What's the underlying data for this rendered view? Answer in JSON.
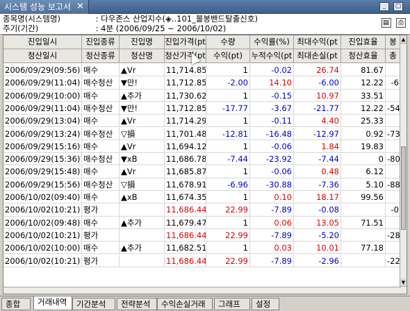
{
  "window": {
    "tab_title": "시스템 성능 보고서",
    "close_glyph": "✕"
  },
  "info": {
    "symbol_label": "종목명(시스템명)",
    "symbol_value": ": 다우존스 산업지수(◈..101_볼봉밴드탈출신호)",
    "period_label": "주기(기간)",
    "period_value": ": 4분 (2006/09/25 ~ 2006/10/02)"
  },
  "headers_top": [
    "진입일시",
    "진입종류",
    "진입명",
    "진입가격(pt",
    "수량",
    "수익률(%)",
    "최대수익(pt",
    "진입효율",
    "봉"
  ],
  "headers_bottom": [
    "청산일시",
    "청산종류",
    "청산명",
    "청산가격(pt",
    "수익(pt)",
    "누적수익(pt",
    "최대손실(pt",
    "청산효율",
    "총"
  ],
  "colors": {
    "red": "#e00000",
    "blue": "#0000d0",
    "black": "#000000"
  },
  "rows": [
    {
      "date": "2006/09/29(09:56)",
      "type": "매수",
      "name": "▲Vr",
      "price": "11,714.85",
      "pcolor": "black",
      "qty": "1",
      "qcolor": "black",
      "rate": "-0.02",
      "rcolor": "blue",
      "max": "26.74",
      "mcolor": "red",
      "eff": "81.67",
      "bar": ""
    },
    {
      "date": "2006/09/29(11:04)",
      "type": "매수청산",
      "name": "▼만!",
      "price": "11,712.85",
      "pcolor": "black",
      "qty": "-2.00",
      "qcolor": "blue",
      "rate": "14.10",
      "rcolor": "red",
      "max": "-6.00",
      "mcolor": "blue",
      "eff": "12.22",
      "bar": "-6"
    },
    {
      "date": "2006/09/29(10:00)",
      "type": "매수",
      "name": "▲추가",
      "price": "11,730.62",
      "pcolor": "black",
      "qty": "1",
      "qcolor": "black",
      "rate": "-0.15",
      "rcolor": "blue",
      "max": "10.97",
      "mcolor": "red",
      "eff": "33.51",
      "bar": ""
    },
    {
      "date": "2006/09/29(11:04)",
      "type": "매수청산",
      "name": "▼만!",
      "price": "11,712.85",
      "pcolor": "black",
      "qty": "-17.77",
      "qcolor": "blue",
      "rate": "-3.67",
      "rcolor": "blue",
      "max": "-21.77",
      "mcolor": "blue",
      "eff": "12.22",
      "bar": "-54"
    },
    {
      "date": "2006/09/29(13:04)",
      "type": "매수",
      "name": "▲Vr",
      "price": "11,714.29",
      "pcolor": "black",
      "qty": "1",
      "qcolor": "black",
      "rate": "-0.11",
      "rcolor": "blue",
      "max": "4.40",
      "mcolor": "red",
      "eff": "25.33",
      "bar": ""
    },
    {
      "date": "2006/09/29(13:24)",
      "type": "매수청산",
      "name": "▽損",
      "price": "11,701.48",
      "pcolor": "black",
      "qty": "-12.81",
      "qcolor": "blue",
      "rate": "-16.48",
      "rcolor": "blue",
      "max": "-12.97",
      "mcolor": "blue",
      "eff": "0.92",
      "bar": "-73"
    },
    {
      "date": "2006/09/29(15:16)",
      "type": "매수",
      "name": "▲Vr",
      "price": "11,694.12",
      "pcolor": "black",
      "qty": "1",
      "qcolor": "black",
      "rate": "-0.06",
      "rcolor": "blue",
      "max": "1.84",
      "mcolor": "red",
      "eff": "19.83",
      "bar": ""
    },
    {
      "date": "2006/09/29(15:36)",
      "type": "매수청산",
      "name": "▼xB",
      "price": "11,686.78",
      "pcolor": "black",
      "qty": "-7.44",
      "qcolor": "blue",
      "rate": "-23.92",
      "rcolor": "blue",
      "max": "-7.44",
      "mcolor": "blue",
      "eff": "0",
      "bar": "-80"
    },
    {
      "date": "2006/09/29(15:48)",
      "type": "매수",
      "name": "▲Vr",
      "price": "11,685.87",
      "pcolor": "black",
      "qty": "1",
      "qcolor": "black",
      "rate": "-0.06",
      "rcolor": "blue",
      "max": "0.48",
      "mcolor": "red",
      "eff": "6.12",
      "bar": ""
    },
    {
      "date": "2006/09/29(15:56)",
      "type": "매수청산",
      "name": "▽損",
      "price": "11,678.91",
      "pcolor": "black",
      "qty": "-6.96",
      "qcolor": "blue",
      "rate": "-30.88",
      "rcolor": "blue",
      "max": "-7.36",
      "mcolor": "blue",
      "eff": "5.10",
      "bar": "-88"
    },
    {
      "date": "2006/10/02(09:40)",
      "type": "매수",
      "name": "▲xB",
      "price": "11,674.35",
      "pcolor": "black",
      "qty": "1",
      "qcolor": "black",
      "rate": "0.10",
      "rcolor": "red",
      "max": "18.17",
      "mcolor": "red",
      "eff": "99.56",
      "bar": ""
    },
    {
      "date": "2006/10/02(10:21)",
      "type": "평가",
      "name": "",
      "price": "11,686.44",
      "pcolor": "red",
      "qty": "22.99",
      "qcolor": "red",
      "rate": "-7.89",
      "rcolor": "blue",
      "max": "-0.08",
      "mcolor": "blue",
      "eff": "",
      "bar": "-0"
    },
    {
      "date": "2006/10/02(09:48)",
      "type": "매수",
      "name": "▲추가",
      "price": "11,679.47",
      "pcolor": "black",
      "qty": "1",
      "qcolor": "black",
      "rate": "0.06",
      "rcolor": "red",
      "max": "13.05",
      "mcolor": "red",
      "eff": "71.51",
      "bar": ""
    },
    {
      "date": "2006/10/02(10:21)",
      "type": "평가",
      "name": "",
      "price": "11,686.44",
      "pcolor": "red",
      "qty": "22.99",
      "qcolor": "red",
      "rate": "-7.89",
      "rcolor": "blue",
      "max": "-5.20",
      "mcolor": "blue",
      "eff": "",
      "bar": "-28"
    },
    {
      "date": "2006/10/02(10:00)",
      "type": "매수",
      "name": "▲추가",
      "price": "11,682.51",
      "pcolor": "black",
      "qty": "1",
      "qcolor": "black",
      "rate": "0.03",
      "rcolor": "red",
      "max": "10.01",
      "mcolor": "red",
      "eff": "77.18",
      "bar": ""
    },
    {
      "date": "2006/10/02(10:21)",
      "type": "평가",
      "name": "",
      "price": "11,686.44",
      "pcolor": "red",
      "qty": "22.99",
      "qcolor": "red",
      "rate": "-7.89",
      "rcolor": "blue",
      "max": "-2.96",
      "mcolor": "blue",
      "eff": "",
      "bar": "-22"
    }
  ],
  "bottom_tabs": [
    "종합",
    "거래내역",
    "기간분석",
    "전략분석",
    "수익손실거래",
    "그래프",
    "설정"
  ],
  "active_tab": "거래내역",
  "icons": {
    "save": "save-icon",
    "print": "print-icon",
    "scroll_up": "▲",
    "scroll_down": "▼"
  }
}
